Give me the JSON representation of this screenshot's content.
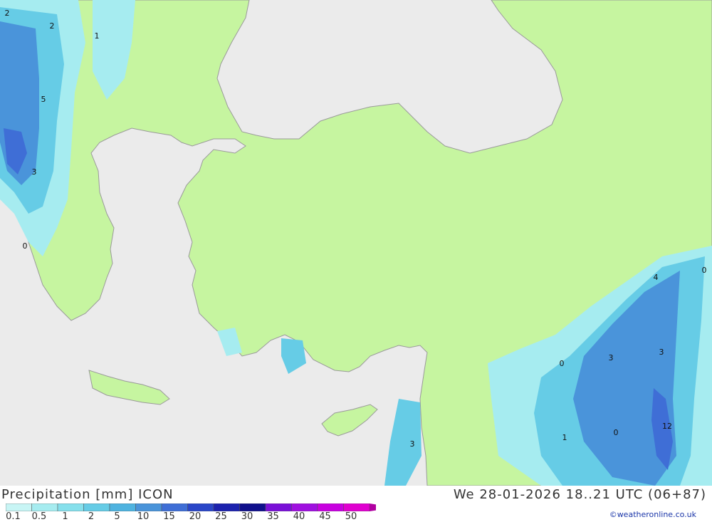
{
  "header": {
    "title": "Precipitation [mm] ICON",
    "timestamp": "We 28-01-2026 18..21 UTC (06+87)",
    "credit": "©weatheronline.co.uk"
  },
  "legend": {
    "labels": [
      "0.1",
      "0.5",
      "1",
      "2",
      "5",
      "10",
      "15",
      "20",
      "25",
      "30",
      "35",
      "40",
      "45",
      "50"
    ],
    "colors": [
      "#c8f5f5",
      "#a6ecf0",
      "#86e0ec",
      "#66cce6",
      "#4fb3e0",
      "#4a94da",
      "#3f6ed6",
      "#2a46c8",
      "#1c22ae",
      "#10108c",
      "#7a10d8",
      "#a010e0",
      "#c800e0",
      "#e000d0",
      "#b000a0"
    ]
  },
  "map": {
    "colors": {
      "sea": "#ebebeb",
      "land": "#c6f5a0",
      "border": "#9a9a9a"
    },
    "value_labels": [
      "2",
      "2",
      "1",
      "5",
      "3",
      "0",
      "4",
      "0",
      "3",
      "3",
      "0",
      "0",
      "1",
      "12",
      "3"
    ]
  }
}
